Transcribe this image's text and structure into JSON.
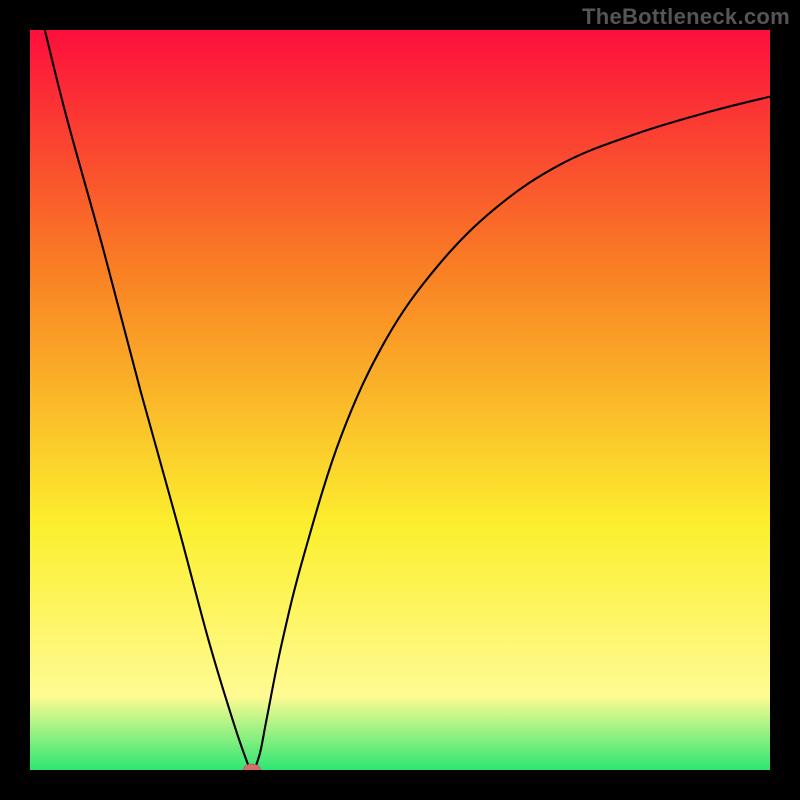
{
  "watermark": "TheBottleneck.com",
  "chart_data": {
    "type": "line",
    "title": "",
    "xlabel": "",
    "ylabel": "",
    "xlim": [
      0,
      100
    ],
    "ylim": [
      0,
      100
    ],
    "colors": {
      "top": "#fc0f3c",
      "mid_upper": "#f97e24",
      "mid": "#fcef2e",
      "near_bottom": "#fffb93",
      "bottom": "#2de673"
    },
    "series": [
      {
        "name": "curve",
        "x": [
          2,
          5,
          10,
          15,
          20,
          24,
          27,
          29,
          30,
          31,
          32,
          34,
          37,
          42,
          48,
          55,
          63,
          72,
          82,
          92,
          100
        ],
        "y": [
          100,
          88,
          70,
          51,
          33,
          18,
          8,
          2,
          0,
          2,
          7,
          17,
          29,
          45,
          58,
          68,
          76,
          82,
          86,
          89,
          91
        ]
      }
    ],
    "marker": {
      "x": 30,
      "y": 0,
      "rx": 1.2,
      "ry": 0.8,
      "color": "#d1706f"
    },
    "grid": false,
    "legend": false
  }
}
